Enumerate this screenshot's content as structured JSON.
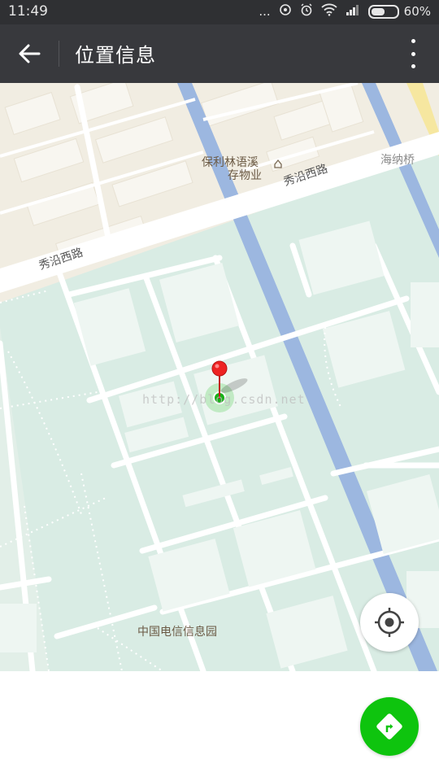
{
  "status_bar": {
    "time": "11:49",
    "signal_dots": "...",
    "battery": "60%",
    "battery_level": 0.6,
    "icons": [
      "hotspot-icon",
      "alarm-icon",
      "wifi-icon",
      "signal-icon",
      "battery-icon"
    ]
  },
  "app_bar": {
    "title": "位置信息",
    "back_icon": "arrow-left-icon",
    "more_icon": "more-vertical-icon"
  },
  "map": {
    "labels": {
      "poi_property_line1": "保利林语溪",
      "poi_property_line2": "存物业",
      "road_xiuyan_upper": "秀沿西路",
      "road_xiuyan_lower": "秀沿西路",
      "bridge": "海纳桥",
      "telecom_park": "中国电信信息园"
    },
    "watermark": "http://blog.csdn.net",
    "colors": {
      "background": "#d9ece4",
      "residential": "#f2eee4",
      "river": "#9cb7e0",
      "road": "#ffffff",
      "pin": "#ee2222",
      "location_dot": "#19b019"
    }
  },
  "controls": {
    "locate_icon": "crosshair-icon",
    "navigate_icon": "route-turn-icon",
    "navigate_color": "#0ec40e"
  }
}
